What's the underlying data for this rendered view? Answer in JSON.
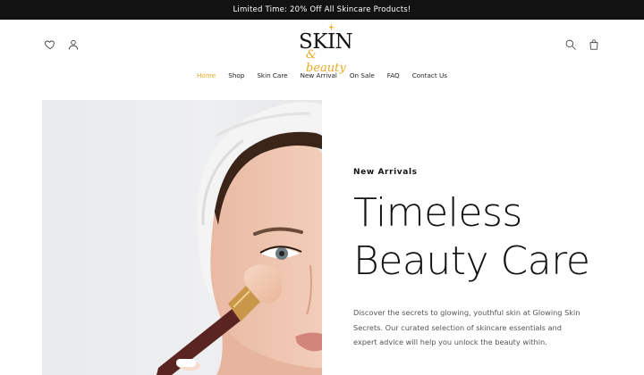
{
  "announcement": "Limited Time: 20% Off All Skincare Products!",
  "logo": {
    "main": "SKIN",
    "script": "& beauty"
  },
  "header": {
    "icons": [
      "heart-icon",
      "user-icon",
      "search-icon",
      "shopping-bag-icon"
    ]
  },
  "nav": [
    {
      "label": "Home",
      "active": true
    },
    {
      "label": "Shop"
    },
    {
      "label": "Skin Care"
    },
    {
      "label": "New Arrival"
    },
    {
      "label": "On Sale"
    },
    {
      "label": "FAQ"
    },
    {
      "label": "Contact Us"
    }
  ],
  "hero": {
    "eyebrow": "New Arrivals",
    "headline_line1": "Timeless",
    "headline_line2": "Beauty Care",
    "description": "Discover the secrets to glowing, youthful skin at Glowing Skin Secrets. Our curated selection of skincare essentials and expert advice will help you unlock the beauty within."
  },
  "colors": {
    "accent": "#e9a825",
    "announcement_bg": "#121212",
    "text": "#111111"
  }
}
